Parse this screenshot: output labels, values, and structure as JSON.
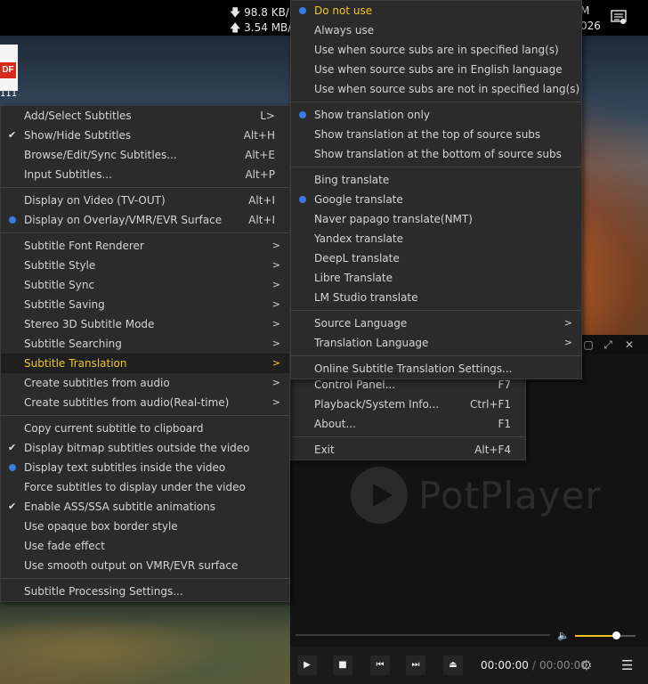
{
  "taskbar": {
    "net_down": "98.8 KB/",
    "net_up": "3.54 MB/",
    "clock_top": "M",
    "clock_bottom": "026"
  },
  "desktop": {
    "file_badge": "DF",
    "file_label": "111"
  },
  "main_menu": {
    "items": [
      {
        "label": "Add/Select Subtitles",
        "shortcut": "L>",
        "mark": "none"
      },
      {
        "label": "Show/Hide Subtitles",
        "shortcut": "Alt+H",
        "mark": "check"
      },
      {
        "label": "Browse/Edit/Sync Subtitles...",
        "shortcut": "Alt+E",
        "mark": "none"
      },
      {
        "label": "Input Subtitles...",
        "shortcut": "Alt+P",
        "mark": "none"
      },
      {
        "label": "Display on Video (TV-OUT)",
        "shortcut": "Alt+I",
        "mark": "none"
      },
      {
        "label": "Display on Overlay/VMR/EVR Surface",
        "shortcut": "Alt+I",
        "mark": "radio"
      },
      {
        "label": "Subtitle Font Renderer",
        "arrow": ">"
      },
      {
        "label": "Subtitle Style",
        "arrow": ">"
      },
      {
        "label": "Subtitle Sync",
        "arrow": ">"
      },
      {
        "label": "Subtitle Saving",
        "arrow": ">"
      },
      {
        "label": "Stereo 3D Subtitle Mode",
        "arrow": ">"
      },
      {
        "label": "Subtitle Searching",
        "arrow": ">"
      },
      {
        "label": "Subtitle Translation",
        "arrow": ">"
      },
      {
        "label": "Create subtitles from audio",
        "arrow": ">"
      },
      {
        "label": "Create subtitles from audio(Real-time)",
        "arrow": ">"
      },
      {
        "label": "Copy current subtitle to clipboard"
      },
      {
        "label": "Display bitmap subtitles outside the video",
        "mark": "check"
      },
      {
        "label": "Display text subtitles inside the video",
        "mark": "radio"
      },
      {
        "label": "Force subtitles to display under the video"
      },
      {
        "label": "Enable ASS/SSA subtitle animations",
        "mark": "check"
      },
      {
        "label": "Use opaque box border style"
      },
      {
        "label": "Use fade effect"
      },
      {
        "label": "Use smooth output on VMR/EVR surface"
      },
      {
        "label": "Subtitle Processing Settings..."
      }
    ]
  },
  "translation_menu": {
    "items": [
      {
        "label": "Do not use"
      },
      {
        "label": "Always use"
      },
      {
        "label": "Use when source subs are in specified lang(s)"
      },
      {
        "label": "Use when source subs are in English language"
      },
      {
        "label": "Use when source subs are not in specified lang(s)"
      },
      {
        "label": "Show translation only"
      },
      {
        "label": "Show translation at the top of source subs"
      },
      {
        "label": "Show translation at the bottom of source subs"
      },
      {
        "label": "Bing translate"
      },
      {
        "label": "Google translate"
      },
      {
        "label": "Naver papago translate(NMT)"
      },
      {
        "label": "Yandex translate"
      },
      {
        "label": "DeepL translate"
      },
      {
        "label": "Libre Translate"
      },
      {
        "label": "LM Studio translate"
      },
      {
        "label": "Source Language",
        "arrow": ">"
      },
      {
        "label": "Translation Language",
        "arrow": ">"
      },
      {
        "label": "Online Subtitle Translation Settings..."
      }
    ]
  },
  "under_menu": {
    "items": [
      {
        "label": "Control Panel...",
        "shortcut": "F7"
      },
      {
        "label": "Playback/System Info...",
        "shortcut": "Ctrl+F1"
      },
      {
        "label": "About...",
        "shortcut": "F1"
      },
      {
        "label": "Exit",
        "shortcut": "Alt+F4"
      }
    ]
  },
  "player": {
    "logo_text": "PotPlayer",
    "time_current": "00:00:00",
    "time_separator": "/",
    "time_total": "00:00:00",
    "volume_level": 0.68
  },
  "colors": {
    "accent": "#f2c522",
    "radio": "#3a7be0",
    "menu_bg": "#2b2b2b"
  }
}
